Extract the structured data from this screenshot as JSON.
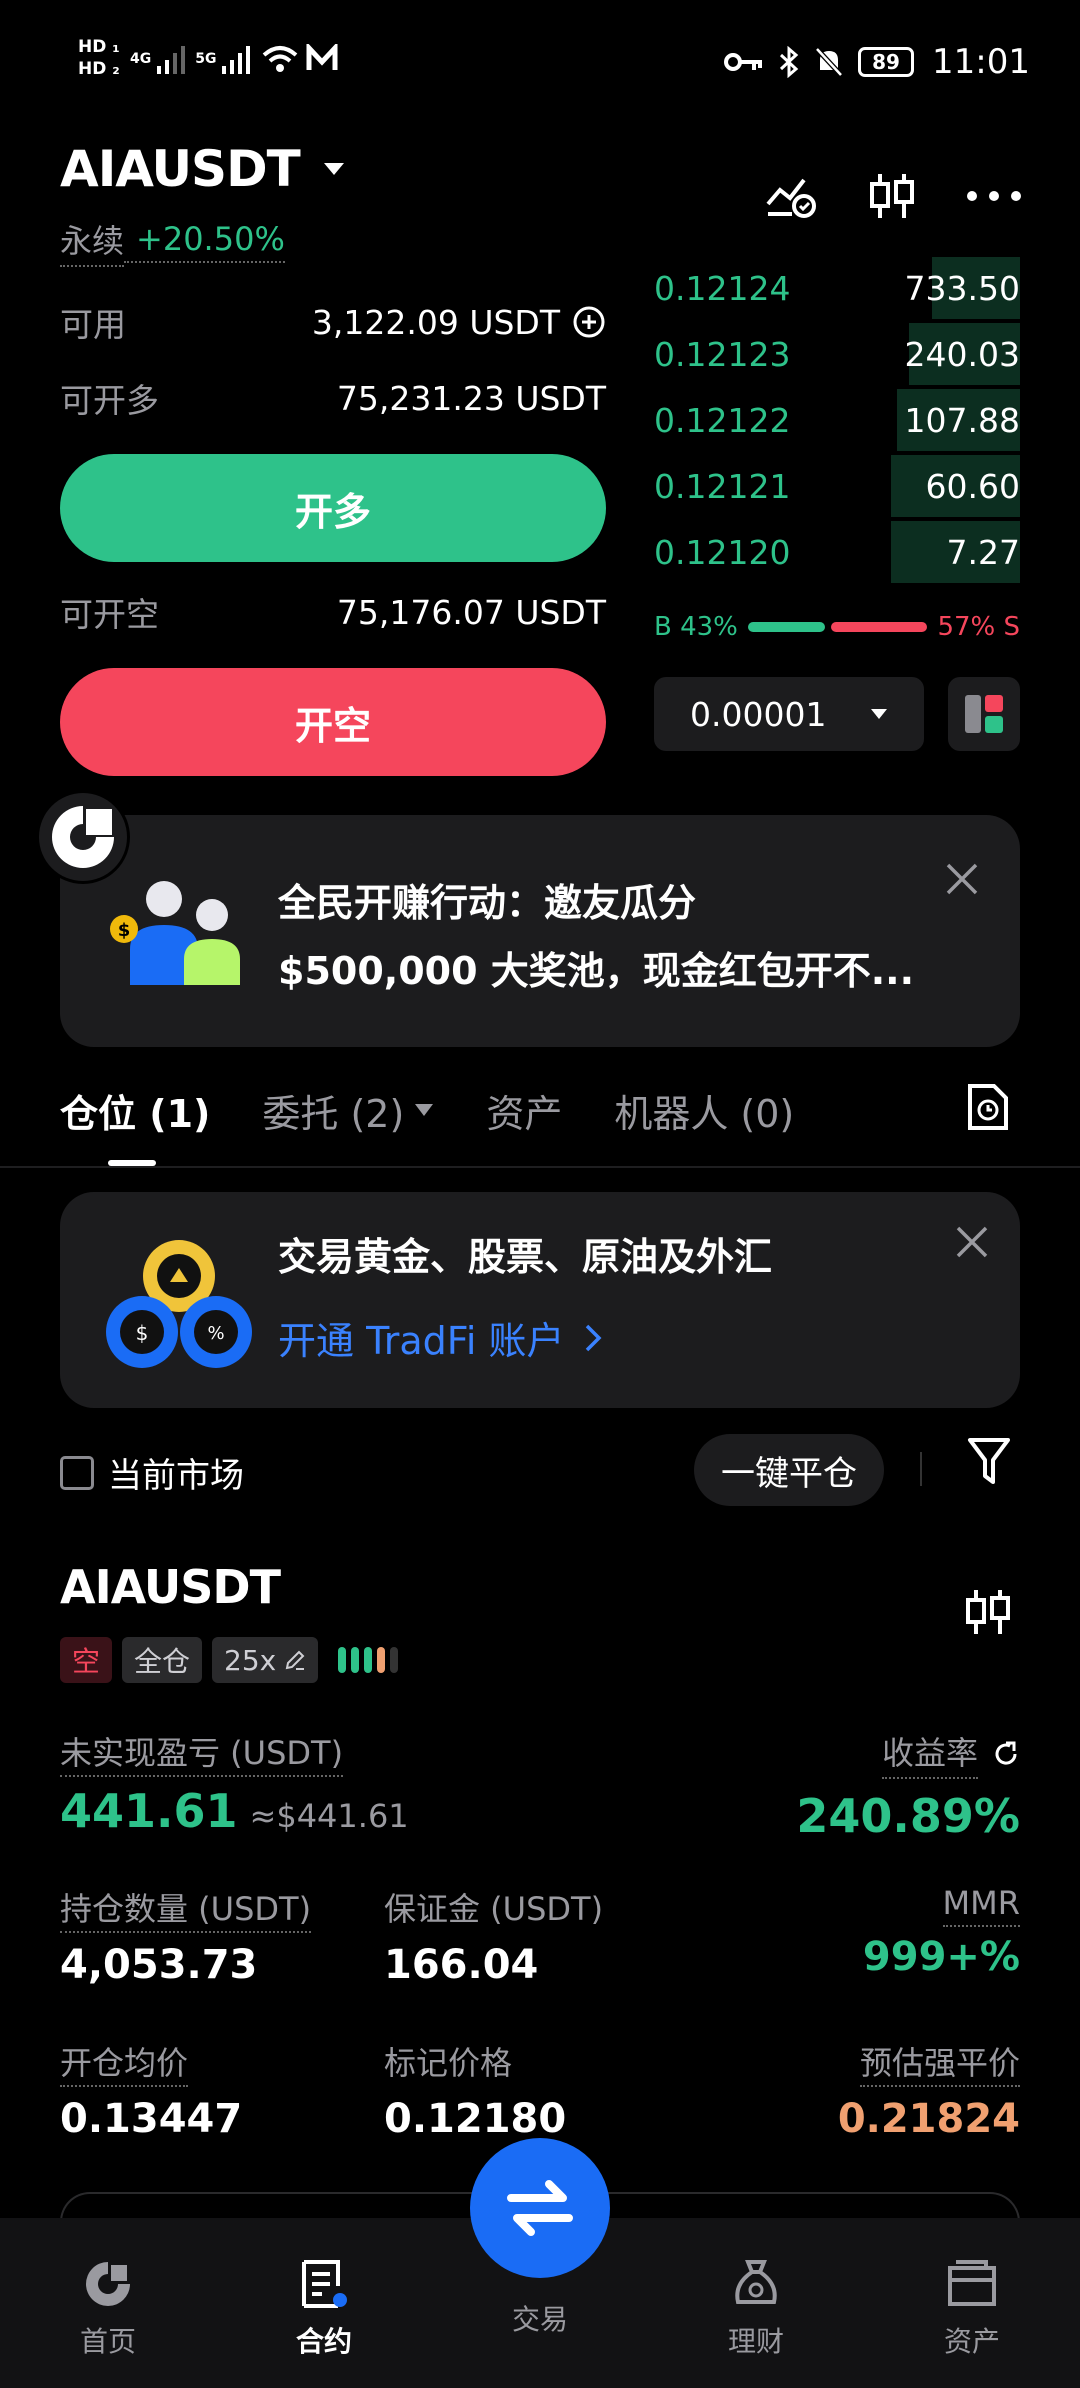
{
  "status_bar": {
    "hd1": "HD",
    "hd2": "HD",
    "net1": "4G",
    "net2": "5G",
    "battery": "89",
    "time": "11:01"
  },
  "header": {
    "pair": "AIAUSDT",
    "perp_label": "永续",
    "change": "+20.50%"
  },
  "account": {
    "available_label": "可用",
    "available_value": "3,122.09 USDT",
    "long_label": "可开多",
    "long_value": "75,231.23 USDT",
    "long_button": "开多",
    "short_label": "可开空",
    "short_value": "75,176.07 USDT",
    "short_button": "开空"
  },
  "orderbook": {
    "rows": [
      {
        "price": "0.12124",
        "qty": "733.50",
        "depth": 0.15
      },
      {
        "price": "0.12123",
        "qty": "240.03",
        "depth": 0.19
      },
      {
        "price": "0.12122",
        "qty": "107.88",
        "depth": 0.21
      },
      {
        "price": "0.12121",
        "qty": "60.60",
        "depth": 0.22
      },
      {
        "price": "0.12120",
        "qty": "7.27",
        "depth": 0.22
      }
    ],
    "buy_ratio": "B 43%",
    "sell_ratio": "57% S",
    "buy_fraction": 0.43,
    "precision": "0.00001"
  },
  "promo1": {
    "line1": "全民开赚行动：邀友瓜分",
    "line2": "$500,000 大奖池，现金红包开不..."
  },
  "tabs": [
    {
      "label": "仓位 (1)"
    },
    {
      "label": "委托 (2)"
    },
    {
      "label": "资产"
    },
    {
      "label": "机器人 (0)"
    }
  ],
  "promo2": {
    "line1": "交易黄金、股票、原油及外汇",
    "link": "开通 TradFi 账户"
  },
  "filters": {
    "current_market": "当前市场",
    "close_all": "一键平仓"
  },
  "position": {
    "pair": "AIAUSDT",
    "side": "空",
    "margin_mode": "全仓",
    "leverage": "25x",
    "pnl_label": "未实现盈亏 (USDT)",
    "pnl_value": "441.61",
    "pnl_usd": "≈$441.61",
    "roi_label": "收益率",
    "roi_value": "240.89%",
    "size_label": "持仓数量 (USDT)",
    "size_value": "4,053.73",
    "margin_label": "保证金 (USDT)",
    "margin_value": "166.04",
    "mmr_label": "MMR",
    "mmr_value": "999+%",
    "entry_label": "开仓均价",
    "entry_value": "0.13447",
    "mark_label": "标记价格",
    "mark_value": "0.12180",
    "liq_label": "预估强平价",
    "liq_value": "0.21824"
  },
  "bottom_nav": [
    {
      "label": "首页",
      "icon": "home-icon"
    },
    {
      "label": "合约",
      "icon": "contract-icon"
    },
    {
      "label": "交易",
      "icon": "trade-swap-icon"
    },
    {
      "label": "理财",
      "icon": "finance-icon"
    },
    {
      "label": "资产",
      "icon": "wallet-icon"
    }
  ],
  "colors": {
    "green": "#2ec28a",
    "red": "#f5465c",
    "blue": "#1a6cf5",
    "orange": "#f0a070"
  }
}
